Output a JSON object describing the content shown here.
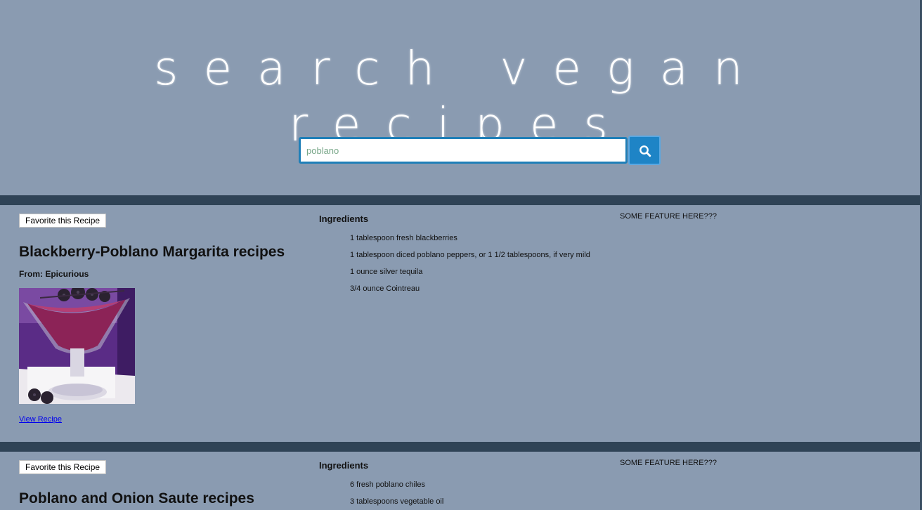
{
  "header": {
    "title": "search vegan recipes"
  },
  "search": {
    "value": "poblano",
    "button_icon": "search-icon"
  },
  "colors": {
    "background": "#8a9bb1",
    "divider": "#2f4356",
    "accent": "#1e84c6",
    "link": "#0000ee"
  },
  "recipes": [
    {
      "favorite_label": "Favorite this Recipe",
      "title": "Blackberry-Poblano Margarita recipes",
      "source": "From: Epicurious",
      "image": "margarita-with-blackberries",
      "link_label": "View Recipe",
      "ingredients_header": "Ingredients",
      "ingredients": [
        "1 tablespoon fresh blackberries",
        "1 tablespoon diced poblano peppers, or 1 1/2 tablespoons, if very mild",
        "1 ounce silver tequila",
        "3/4 ounce Cointreau"
      ],
      "feature": "SOME FEATURE HERE???"
    },
    {
      "favorite_label": "Favorite this Recipe",
      "title": "Poblano and Onion Saute recipes",
      "ingredients_header": "Ingredients",
      "ingredients": [
        "6 fresh poblano chiles",
        "3 tablespoons vegetable oil"
      ],
      "feature": "SOME FEATURE HERE???"
    }
  ]
}
